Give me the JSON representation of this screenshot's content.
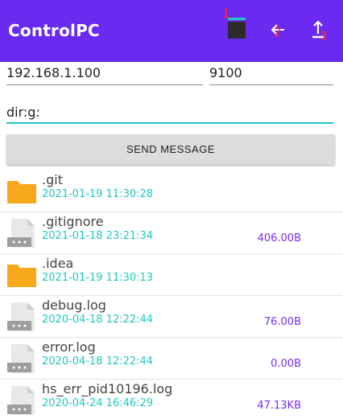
{
  "appbar": {
    "title": "ControlPC",
    "badges": [
      "1",
      "2",
      "3"
    ],
    "icons": [
      "stop-square-icon",
      "back-arrow-icon",
      "upload-icon"
    ],
    "color": "#6a2af0"
  },
  "connection": {
    "ip": "192.168.1.100",
    "port": "9100",
    "command": "dir:g:"
  },
  "send_button": {
    "label": "SEND MESSAGE"
  },
  "files": [
    {
      "name": ".git",
      "date": "2021-01-19 11:30:28",
      "size": "",
      "type": "folder"
    },
    {
      "name": ".gitignore",
      "date": "2021-01-18 23:21:34",
      "size": "406.00B",
      "type": "file"
    },
    {
      "name": ".idea",
      "date": "2021-01-19 11:30:13",
      "size": "",
      "type": "folder"
    },
    {
      "name": "debug.log",
      "date": "2020-04-18 12:22:44",
      "size": "76.00B",
      "type": "file"
    },
    {
      "name": "error.log",
      "date": "2020-04-18 12:22:44",
      "size": "0.00B",
      "type": "file"
    },
    {
      "name": "hs_err_pid10196.log",
      "date": "2020-04-24 16:46:29",
      "size": "47.13KB",
      "type": "file"
    }
  ],
  "colors": {
    "date": "#1ec9c0",
    "size": "#7b2cf5",
    "folder": "#f7a81b",
    "badge": "#ff2a2a"
  }
}
